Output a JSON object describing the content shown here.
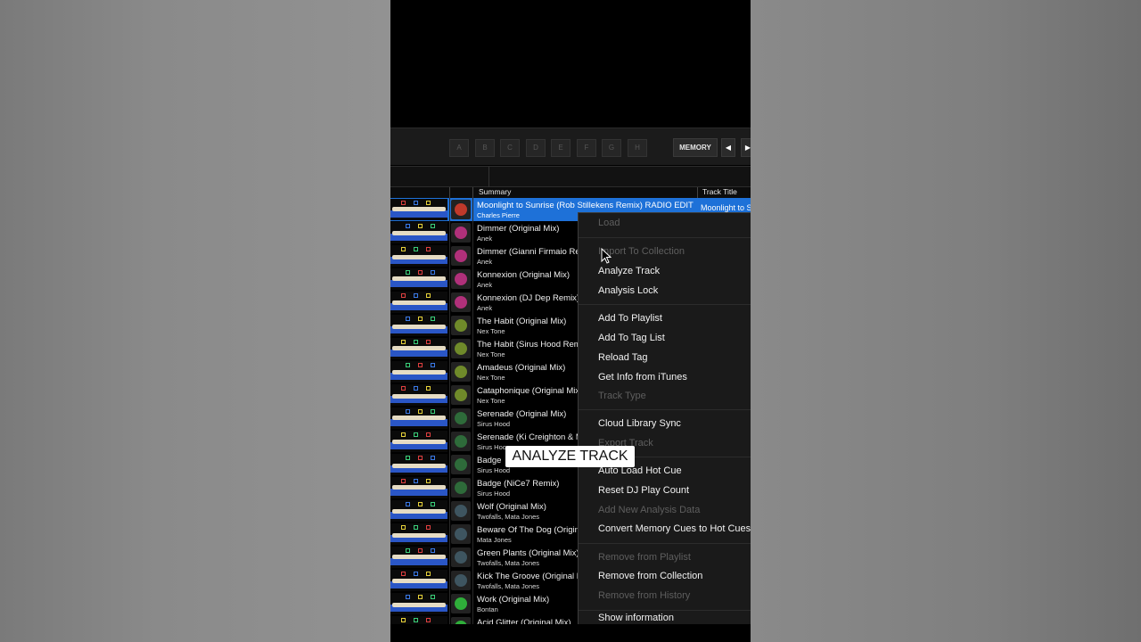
{
  "hot_cue_buttons": [
    "A",
    "B",
    "C",
    "D",
    "E",
    "F",
    "G",
    "H"
  ],
  "memory_label": "MEMORY",
  "prev_icon": "◀",
  "next_icon": "▶",
  "columns": {
    "summary": "Summary",
    "track_title": "Track Title"
  },
  "selected_track_title_cell": "Moonlight to S",
  "tracks": [
    {
      "title": "Moonlight to Sunrise (Rob Stillekens Remix) RADIO EDIT",
      "artist": "Charles Pierre",
      "selected": true,
      "art_color": "#c0392b"
    },
    {
      "title": "Dimmer (Original Mix)",
      "artist": "Anek",
      "art_color": "#b0307a"
    },
    {
      "title": "Dimmer (Gianni Firmaio Re",
      "artist": "Anek",
      "art_color": "#b0307a"
    },
    {
      "title": "Konnexion (Original Mix)",
      "artist": "Anek",
      "art_color": "#b0307a"
    },
    {
      "title": "Konnexion (DJ Dep Remix)",
      "artist": "Anek",
      "art_color": "#b0307a"
    },
    {
      "title": "The Habit (Original Mix)",
      "artist": "Nex Tone",
      "art_color": "#6f8a2a"
    },
    {
      "title": "The Habit (Sirus Hood Rem",
      "artist": "Nex Tone",
      "art_color": "#6f8a2a"
    },
    {
      "title": "Amadeus (Original Mix)",
      "artist": "Nex Tone",
      "art_color": "#6f8a2a"
    },
    {
      "title": "Cataphonique (Original Mix",
      "artist": "Nex Tone",
      "art_color": "#6f8a2a"
    },
    {
      "title": "Serenade (Original Mix)",
      "artist": "Sirus Hood",
      "art_color": "#2e6b3a"
    },
    {
      "title": "Serenade (Ki Creighton & M",
      "artist": "Sirus Hoo",
      "art_color": "#2e6b3a"
    },
    {
      "title": "Badge",
      "artist": "Sirus Hood",
      "art_color": "#2e6b3a"
    },
    {
      "title": "Badge (NiCe7 Remix)",
      "artist": "Sirus Hood",
      "art_color": "#2e6b3a"
    },
    {
      "title": "Wolf (Original Mix)",
      "artist": "Twofalls, Mata Jones",
      "art_color": "#3e5560"
    },
    {
      "title": "Beware Of The Dog (Origin",
      "artist": "Mata Jones",
      "art_color": "#3e5560"
    },
    {
      "title": "Green Plants (Original Mix)",
      "artist": "Twofalls, Mata Jones",
      "art_color": "#3e5560"
    },
    {
      "title": "Kick The Groove (Original N",
      "artist": "Twofalls, Mata Jones",
      "art_color": "#3e5560"
    },
    {
      "title": "Work (Original Mix)",
      "artist": "Bontan",
      "art_color": "#2fae3a"
    },
    {
      "title": "Acid Glitter (Original Mix)",
      "artist": "",
      "art_color": "#2fae3a"
    }
  ],
  "context_menu": [
    {
      "label": "Load",
      "disabled": true
    },
    {
      "label": "Import To Collection",
      "disabled": true
    },
    {
      "label": "Analyze Track",
      "disabled": false
    },
    {
      "label": "Analysis Lock",
      "disabled": false
    },
    {
      "label": "Add To Playlist",
      "disabled": false
    },
    {
      "label": "Add To Tag List",
      "disabled": false
    },
    {
      "label": "Reload Tag",
      "disabled": false
    },
    {
      "label": "Get Info from iTunes",
      "disabled": false
    },
    {
      "label": "Track Type",
      "disabled": true
    },
    {
      "label": "Cloud Library Sync",
      "disabled": false
    },
    {
      "label": "Export Track",
      "disabled": true
    },
    {
      "label": "Auto Load Hot Cue",
      "disabled": false
    },
    {
      "label": "Reset DJ Play Count",
      "disabled": false
    },
    {
      "label": "Add New Analysis Data",
      "disabled": true
    },
    {
      "label": "Convert Memory Cues to Hot Cues",
      "disabled": false
    },
    {
      "label": "Remove from Playlist",
      "disabled": true
    },
    {
      "label": "Remove from Collection",
      "disabled": false
    },
    {
      "label": "Remove from History",
      "disabled": true
    },
    {
      "label": "Show information",
      "disabled": false
    }
  ],
  "caption": "ANALYZE TRACK",
  "colors": {
    "selection": "#1e71d8",
    "waveform_blue": "#2a56c6"
  }
}
